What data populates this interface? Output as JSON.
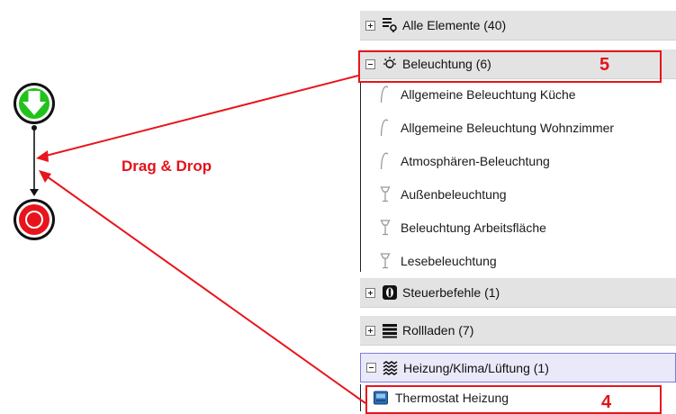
{
  "workflow": {
    "drag_label": "Drag & Drop",
    "start_icon": "green-down-arrow-start-node",
    "end_icon": "red-stop-end-node"
  },
  "tree": {
    "groups": [
      {
        "label": "Alle Elemente (40)",
        "icon": "elements-list-icon",
        "expanded": false
      },
      {
        "label": "Beleuchtung (6)",
        "icon": "light-bulb-icon",
        "expanded": true
      },
      {
        "label": "Steuerbefehle (1)",
        "icon": "control-command-icon",
        "expanded": false
      },
      {
        "label": "Rollladen (7)",
        "icon": "shutter-icon",
        "expanded": false
      },
      {
        "label": "Heizung/Klima/Lüftung (1)",
        "icon": "heating-icon",
        "expanded": true,
        "selected": true
      }
    ],
    "lighting_items": [
      {
        "label": "Allgemeine Beleuchtung Küche",
        "icon": "ceiling-lamp-icon"
      },
      {
        "label": "Allgemeine Beleuchtung Wohnzimmer",
        "icon": "ceiling-lamp-icon"
      },
      {
        "label": "Atmosphären-Beleuchtung",
        "icon": "ceiling-lamp-icon"
      },
      {
        "label": "Außenbeleuchtung",
        "icon": "pendant-lamp-icon"
      },
      {
        "label": "Beleuchtung Arbeitsfläche",
        "icon": "pendant-lamp-icon"
      },
      {
        "label": "Lesebeleuchtung",
        "icon": "pendant-lamp-icon"
      }
    ],
    "heating_items": [
      {
        "label": "Thermostat Heizung",
        "icon": "thermostat-icon"
      }
    ]
  },
  "annotations": {
    "badge_lighting": "5",
    "badge_thermostat": "4"
  },
  "colors": {
    "accent_red": "#e3121b",
    "start_green": "#22c21d",
    "stop_red": "#e8141c"
  }
}
